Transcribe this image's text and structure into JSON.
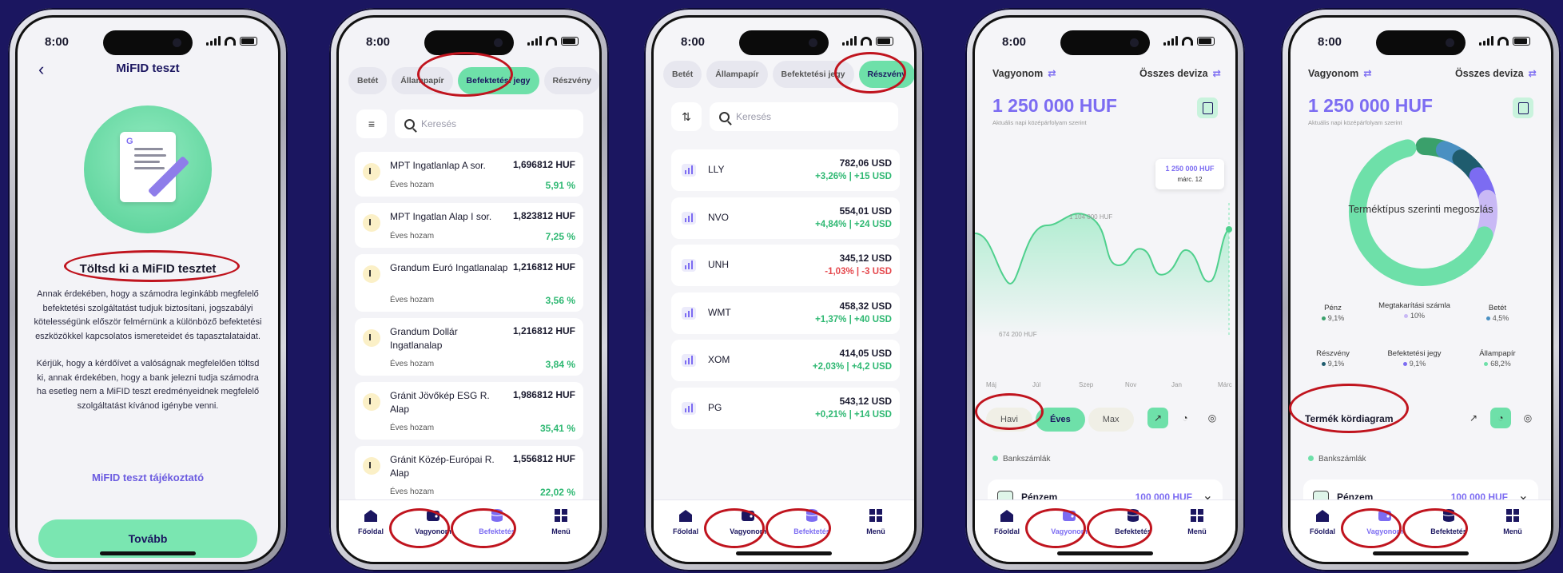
{
  "status_time": "8:00",
  "tabs": {
    "home": "Főoldal",
    "assets": "Vagyonom",
    "invest": "Befektetés",
    "menu": "Menü"
  },
  "mifid": {
    "title": "MiFID teszt",
    "heading": "Töltsd ki a MiFID tesztet",
    "body1": "Annak érdekében, hogy a számodra leginkább megfelelő befektetési szolgáltatást tudjuk biztosítani, jogszabályi kötelességünk először felmérnünk a különböző befektetési eszközökkel kapcsolatos ismereteidet és tapasztalataidat.",
    "body2": "Kérjük, hogy a kérdőívet a valóságnak megfelelően töltsd ki, annak érdekében, hogy a bank jelezni tudja számodra ha esetleg nem a MiFID teszt eredményeidnek megfelelő szolgáltatást kívánod igénybe venni.",
    "link": "MiFID teszt tájékoztató",
    "button": "Tovább"
  },
  "filters": {
    "betet": "Betét",
    "allampapir": "Állampapír",
    "befjegy": "Befektetési jegy",
    "reszveny": "Részvény"
  },
  "search_placeholder": "Keresés",
  "funds": [
    {
      "name": "MPT Ingatlanlap A sor.",
      "price": "1,696812 HUF",
      "yield_label": "Éves hozam",
      "yield": "5,91 %"
    },
    {
      "name": "MPT Ingatlan Alap I sor.",
      "price": "1,823812 HUF",
      "yield_label": "Éves hozam",
      "yield": "7,25 %"
    },
    {
      "name": "Grandum Euró Ingatlanalap",
      "price": "1,216812 HUF",
      "yield_label": "Éves hozam",
      "yield": "3,56 %"
    },
    {
      "name": "Grandum Dollár Ingatlanalap",
      "price": "1,216812 HUF",
      "yield_label": "Éves hozam",
      "yield": "3,84 %"
    },
    {
      "name": "Gránit Jövőkép ESG R. Alap",
      "price": "1,986812 HUF",
      "yield_label": "Éves hozam",
      "yield": "35,41 %"
    },
    {
      "name": "Gránit Közép-Európai R. Alap",
      "price": "1,556812 HUF",
      "yield_label": "Éves hozam",
      "yield": "22,02 %"
    }
  ],
  "stocks": [
    {
      "ticker": "LLY",
      "price": "782,06 USD",
      "change": "+3,26% | +15 USD",
      "dir": "up"
    },
    {
      "ticker": "NVO",
      "price": "554,01 USD",
      "change": "+4,84% | +24 USD",
      "dir": "up"
    },
    {
      "ticker": "UNH",
      "price": "345,12 USD",
      "change": "-1,03% | -3 USD",
      "dir": "down"
    },
    {
      "ticker": "WMT",
      "price": "458,32 USD",
      "change": "+1,37% | +40 USD",
      "dir": "up"
    },
    {
      "ticker": "XOM",
      "price": "414,05 USD",
      "change": "+2,03% | +4,2 USD",
      "dir": "up"
    },
    {
      "ticker": "PG",
      "price": "543,12 USD",
      "change": "+0,21% | +14 USD",
      "dir": "up"
    }
  ],
  "assets": {
    "title": "Vagyonom",
    "currency": "Összes deviza",
    "total": "1 250 000 HUF",
    "subtitle": "Aktuális napi középárfolyam szerint",
    "tooltip_value": "1 250 000 HUF",
    "tooltip_date": "márc. 12",
    "peak_label": "1 104 000 HUF",
    "low_label": "674 200 HUF",
    "months": [
      "Máj",
      "Júl",
      "Szep",
      "Nov",
      "Jan",
      "Márc"
    ],
    "period_monthly": "Havi",
    "period_yearly": "Éves",
    "period_max": "Max",
    "bank_accounts": "Bankszámlák",
    "penzem": "Pénzem",
    "penzem_value": "100 000 HUF",
    "donut_title": "Terméktípus szerinti megoszlás",
    "pie_label": "Termék kördiagram",
    "categories": [
      {
        "name": "Pénz",
        "pct": "9,1%",
        "color": "#3aa06b"
      },
      {
        "name": "Megtakarítási számla",
        "pct": "10%",
        "color": "#c9b9f5"
      },
      {
        "name": "Betét",
        "pct": "4,5%",
        "color": "#4a90c2"
      },
      {
        "name": "Részvény",
        "pct": "9,1%",
        "color": "#1f5c6e"
      },
      {
        "name": "Befektetési jegy",
        "pct": "9,1%",
        "color": "#7c6cf2"
      },
      {
        "name": "Állampapír",
        "pct": "68,2%",
        "color": "#6ee0a9"
      }
    ]
  },
  "chart_data": {
    "type": "line",
    "x": [
      "Máj",
      "Júl",
      "Szep",
      "Nov",
      "Jan",
      "Márc"
    ],
    "annotations": [
      "1 104 000 HUF",
      "674 200 HUF",
      "1 250 000 HUF"
    ]
  }
}
